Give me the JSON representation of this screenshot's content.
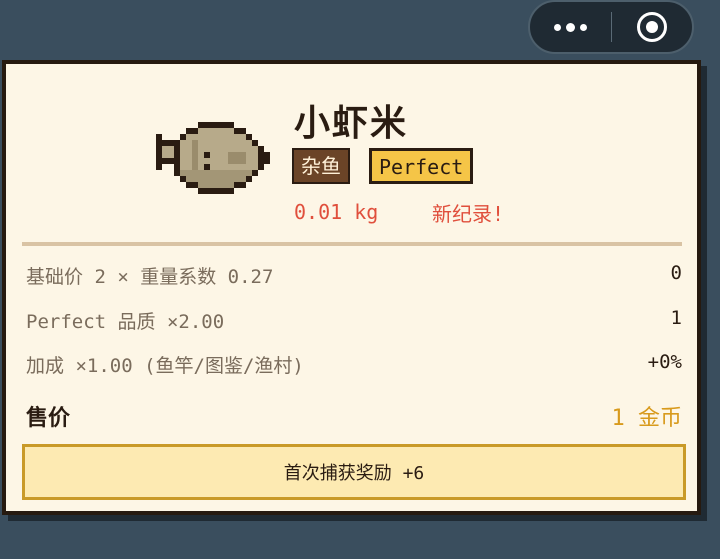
{
  "top_bar": {
    "more_icon": "more-dots-icon",
    "close_icon": "target-close-icon"
  },
  "catch": {
    "fish_icon": "pixel-fish-icon",
    "name": "小虾米",
    "category": "杂鱼",
    "quality": "Perfect",
    "weight": "0.01 kg",
    "record": "新纪录!"
  },
  "breakdown": [
    {
      "label": "基础价 2 × 重量系数 0.27",
      "value": "0"
    },
    {
      "label": "Perfect 品质 ×2.00",
      "value": "1"
    },
    {
      "label": "加成 ×1.00 (鱼竿/图鉴/渔村)",
      "value": "+0%"
    }
  ],
  "sell": {
    "label": "售价",
    "amount": "1 金币"
  },
  "bonus": {
    "text": "首次捕获奖励 +6"
  },
  "colors": {
    "page_bg": "#3a4e5e",
    "card_bg": "#fdf6e6",
    "border": "#261a10",
    "record_red": "#e04f3c",
    "gold": "#d89a1c",
    "quality_yellow": "#f5c547"
  }
}
